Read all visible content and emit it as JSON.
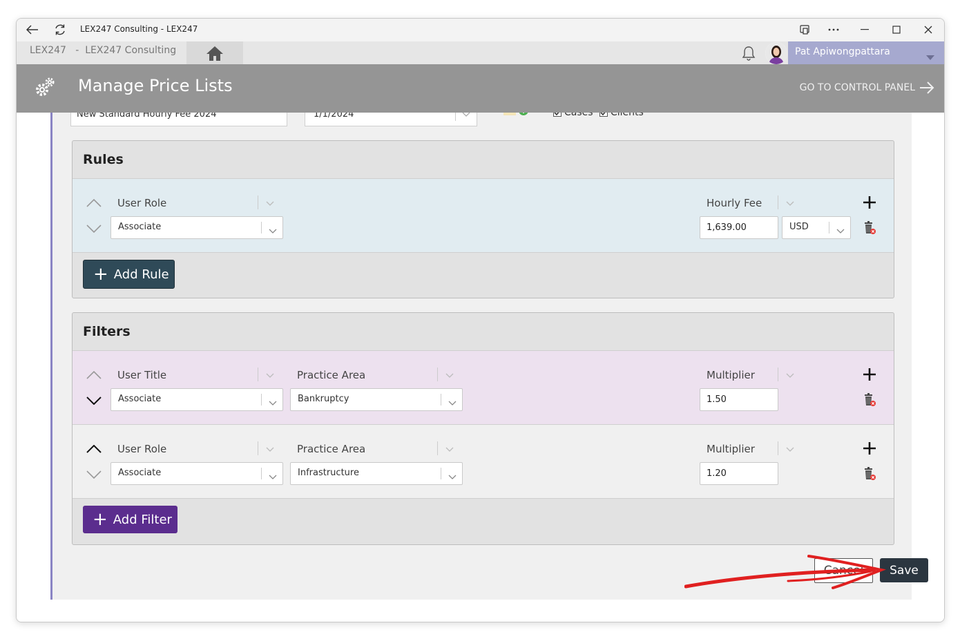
{
  "window": {
    "title": "LEX247 Consulting - LEX247"
  },
  "appbar": {
    "breadcrumb": "LEX247   -  LEX247 Consulting",
    "user_name": "Pat Apiwongpattara"
  },
  "header": {
    "title": "Manage Price Lists",
    "control_panel_link": "GO TO CONTROL PANEL"
  },
  "pricelist": {
    "name": "New Standard Hourly Fee 2024",
    "date": "1/1/2024",
    "applies_cases": "Cases",
    "applies_clients": "Clients"
  },
  "rules": {
    "title": "Rules",
    "rows": [
      {
        "field_label": "User Role",
        "field_value": "Associate",
        "value_label": "Hourly Fee",
        "value": "1,639.00",
        "currency": "USD"
      }
    ],
    "add_label": "Add Rule"
  },
  "filters": {
    "title": "Filters",
    "rows": [
      {
        "field1_label": "User Title",
        "field1_value": "Associate",
        "field2_label": "Practice Area",
        "field2_value": "Bankruptcy",
        "value_label": "Multiplier",
        "value": "1.50"
      },
      {
        "field1_label": "User Role",
        "field1_value": "Associate",
        "field2_label": "Practice Area",
        "field2_value": "Infrastructure",
        "value_label": "Multiplier",
        "value": "1.20"
      }
    ],
    "add_label": "Add Filter"
  },
  "actions": {
    "cancel": "Cancel",
    "save": "Save"
  },
  "colors": {
    "header_bg": "#959595",
    "rule_row_bg": "#e1ecf1",
    "filter_row_bg": "#ede1ef",
    "add_rule_bg": "#2f4a58",
    "add_filter_bg": "#5b2d8e",
    "save_bg": "#2b3640",
    "annotation_arrow": "#e02020"
  }
}
